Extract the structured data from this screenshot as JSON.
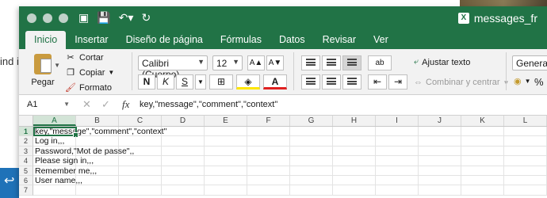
{
  "background": {
    "edge_text": "ind in"
  },
  "window": {
    "title": "messages_fr",
    "title_icon": "excel-file-icon",
    "accent_color": "#217346"
  },
  "tabs": [
    {
      "label": "Inicio",
      "active": true
    },
    {
      "label": "Insertar"
    },
    {
      "label": "Diseño de página"
    },
    {
      "label": "Fórmulas"
    },
    {
      "label": "Datos"
    },
    {
      "label": "Revisar"
    },
    {
      "label": "Ver"
    }
  ],
  "ribbon": {
    "paste_label": "Pegar",
    "cut_label": "Cortar",
    "copy_label": "Copiar",
    "format_label": "Formato",
    "font_name": "Calibri (Cuerpo)",
    "font_size": "12",
    "bold": "N",
    "italic": "K",
    "underline": "S",
    "wrap_text": "Ajustar texto",
    "merge_center": "Combinar y centrar",
    "number_format": "General",
    "percent": "%",
    "font_color": "#e02020",
    "highlight_color": "#ffe600",
    "grow_font": "A▲",
    "shrink_font": "A▼",
    "abc": "ab"
  },
  "formula_bar": {
    "name_box": "A1",
    "fx": "fx",
    "formula": "key,\"message\",\"comment\",\"context\""
  },
  "grid": {
    "columns": [
      "A",
      "B",
      "C",
      "D",
      "E",
      "F",
      "G",
      "H",
      "I",
      "J",
      "K",
      "L"
    ],
    "selected_column": "A",
    "rows": [
      {
        "num": "1",
        "a": "key,\"message\",\"comment\",\"context\""
      },
      {
        "num": "2",
        "a": "Log in,,,"
      },
      {
        "num": "3",
        "a": "Password,\"Mot de passe\",,"
      },
      {
        "num": "4",
        "a": "Please sign in,,,"
      },
      {
        "num": "5",
        "a": "Remember me,,,"
      },
      {
        "num": "6",
        "a": "User name,,,"
      },
      {
        "num": "7",
        "a": ""
      }
    ]
  }
}
